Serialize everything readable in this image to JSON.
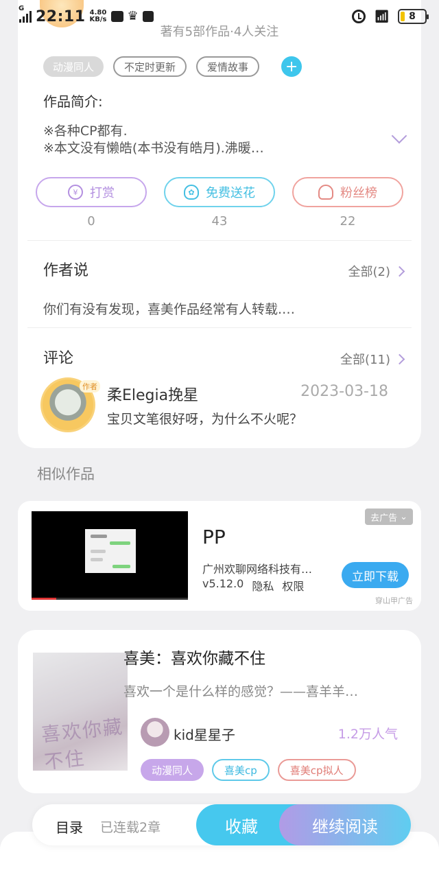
{
  "status_bar": {
    "network": "G",
    "time": "22:11",
    "speed": "4.80",
    "speed_unit": "KB/s",
    "battery": "8"
  },
  "profile": {
    "works_summary": "著有5部作品·4人关注",
    "tags": [
      "动漫同人",
      "不定时更新",
      "爱情故事"
    ],
    "add_tag": "+"
  },
  "intro": {
    "title": "作品简介:",
    "line1": "※各种CP都有.",
    "line2": "※本文没有懒皓(本书没有皓月).沸暖…"
  },
  "actions": [
    {
      "label": "打赏",
      "icon": "yen-icon",
      "count": "0"
    },
    {
      "label": "免费送花",
      "icon": "flower-icon",
      "count": "43"
    },
    {
      "label": "粉丝榜",
      "icon": "person-icon",
      "count": "22"
    }
  ],
  "author_says": {
    "title": "作者说",
    "more": "全部(2)",
    "text": "你们有没有发现，喜美作品经常有人转载.…"
  },
  "comments": {
    "title": "评论",
    "more": "全部(11)",
    "badge": "作者",
    "user": "柔Elegia挽星",
    "date": "2023-03-18",
    "text": "宝贝文笔很好呀，为什么不火呢？"
  },
  "similar": {
    "title": "相似作品"
  },
  "ad": {
    "app_name": "PP",
    "company": "广州欢聊网络科技有…",
    "version": "v5.12.0",
    "privacy": "隐私",
    "permission": "权限",
    "close_label": "去广告",
    "download_label": "立即下载",
    "source": "穿山甲广告"
  },
  "book": {
    "cover_text": "喜欢你藏不住",
    "title": "喜美：喜欢你藏不住",
    "desc": "喜欢一个是什么样的感觉？——喜羊羊…",
    "author": "kid星星子",
    "popularity": "1.2万人气",
    "tags": [
      "动漫同人",
      "喜美cp",
      "喜美cp拟人"
    ]
  },
  "bottom_bar": {
    "toc": "目录",
    "serial": "已连载2章",
    "favorite": "收藏",
    "continue": "继续阅读"
  },
  "colors": {
    "accent_blue": "#46c8ee",
    "accent_purple": "#b19be6",
    "accent_red": "#e48a84"
  }
}
